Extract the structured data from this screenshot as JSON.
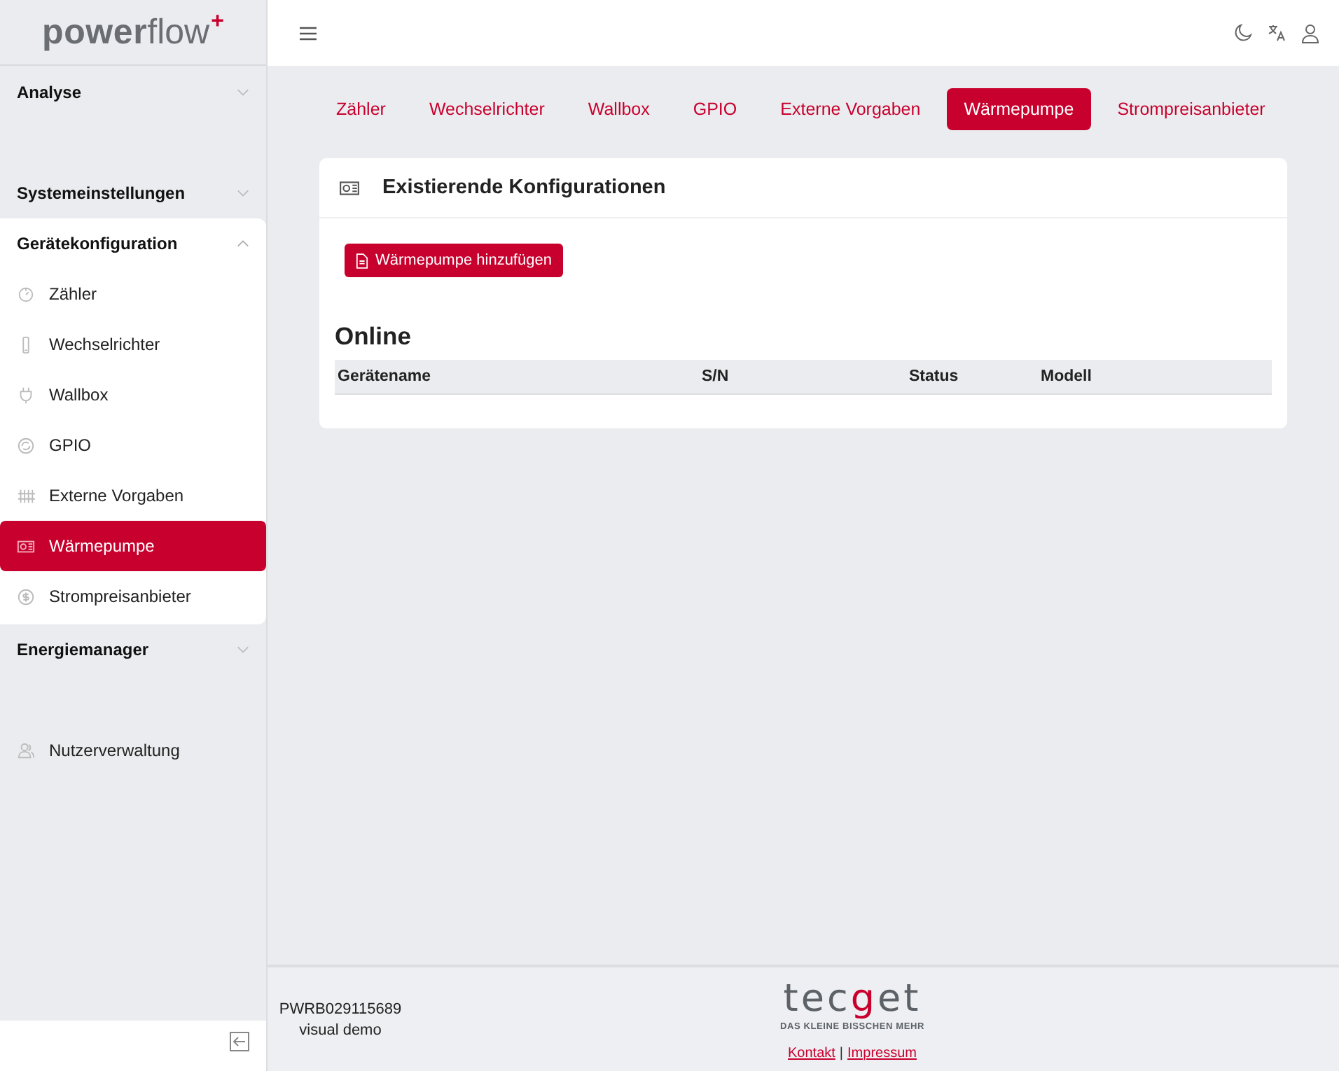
{
  "logo": {
    "bold": "power",
    "light": "flow",
    "mark": "+"
  },
  "sidebar": {
    "items": [
      {
        "kind": "section",
        "label": "Analyse",
        "expanded": false
      },
      {
        "kind": "section",
        "label": "Systemeinstellungen",
        "expanded": false
      },
      {
        "kind": "section",
        "label": "Gerätekonfiguration",
        "expanded": true,
        "children": [
          {
            "label": "Zähler",
            "selected": false
          },
          {
            "label": "Wechselrichter",
            "selected": false
          },
          {
            "label": "Wallbox",
            "selected": false
          },
          {
            "label": "GPIO",
            "selected": false
          },
          {
            "label": "Externe Vorgaben",
            "selected": false
          },
          {
            "label": "Wärmepumpe",
            "selected": true
          },
          {
            "label": "Strompreisanbieter",
            "selected": false
          }
        ]
      },
      {
        "kind": "section",
        "label": "Energiemanager",
        "expanded": false
      },
      {
        "kind": "link",
        "label": "Nutzerverwaltung"
      }
    ]
  },
  "tabs": [
    {
      "label": "Zähler",
      "selected": false
    },
    {
      "label": "Wechselrichter",
      "selected": false
    },
    {
      "label": "Wallbox",
      "selected": false
    },
    {
      "label": "GPIO",
      "selected": false
    },
    {
      "label": "Externe Vorgaben",
      "selected": false
    },
    {
      "label": "Wärmepumpe",
      "selected": true
    },
    {
      "label": "Strompreisanbieter",
      "selected": false
    }
  ],
  "card": {
    "title": "Existierende Konfigurationen",
    "add_button": "Wärmepumpe hinzufügen",
    "section": "Online",
    "table": {
      "columns": [
        "Gerätename",
        "S/N",
        "Status",
        "Modell"
      ]
    }
  },
  "footer": {
    "serial": "PWRB029115689",
    "mode": "visual demo",
    "brand": {
      "parts": [
        {
          "text": "tec",
          "accent": false
        },
        {
          "text": "g",
          "accent": true
        },
        {
          "text": "et",
          "accent": false
        }
      ],
      "tagline": "DAS KLEINE BISSCHEN MEHR"
    },
    "links": [
      "Kontakt",
      "Impressum"
    ],
    "separator": "|"
  }
}
